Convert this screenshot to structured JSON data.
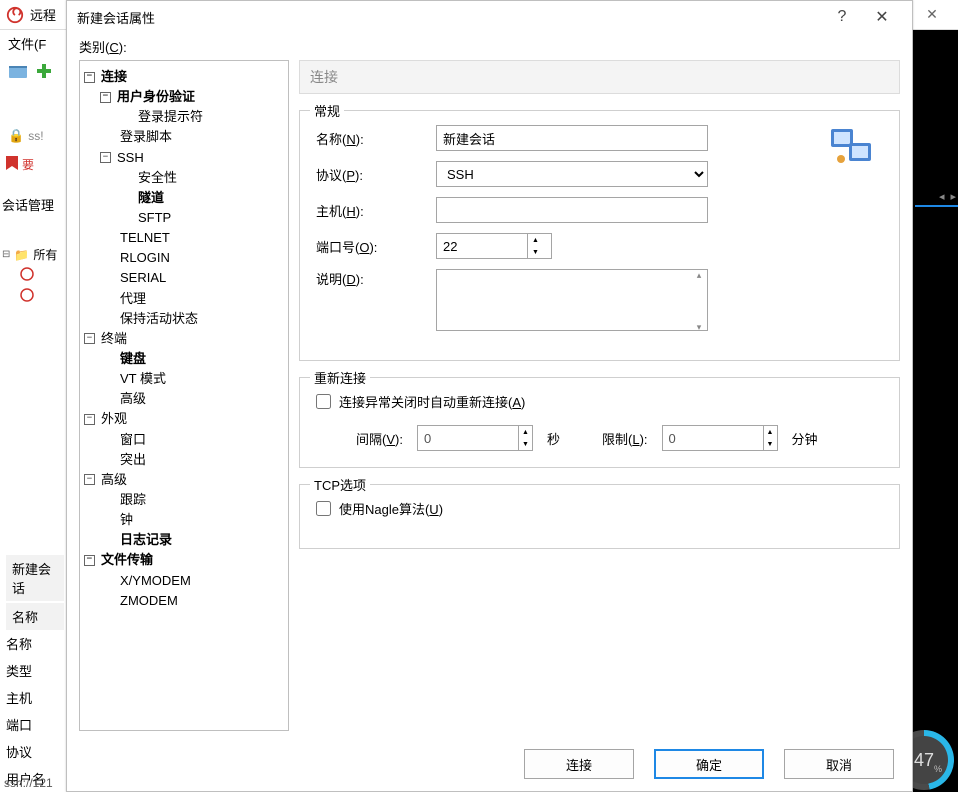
{
  "bg": {
    "title": "远程",
    "menu_file": "文件(F",
    "tab_closed": "ss!",
    "tab_bookmarks": "要",
    "session_manager": "会话管理",
    "tree_all": "所有",
    "status": "ssh://121",
    "progress": "47",
    "details": {
      "header": "新建会话",
      "name_label": "名称",
      "name_value": "名称",
      "type_label": "类型",
      "host_label": "主机",
      "port_label": "端口",
      "protocol_label": "协议",
      "user_label": "用户名"
    }
  },
  "dialog": {
    "title": "新建会话属性",
    "category_label": "类别(C):",
    "content_header": "连接",
    "tree": {
      "connection": "连接",
      "auth": "用户身份验证",
      "login_prompt": "登录提示符",
      "login_script": "登录脚本",
      "ssh": "SSH",
      "security": "安全性",
      "tunnel": "隧道",
      "sftp": "SFTP",
      "telnet": "TELNET",
      "rlogin": "RLOGIN",
      "serial": "SERIAL",
      "proxy": "代理",
      "keepalive": "保持活动状态",
      "terminal": "终端",
      "keyboard": "键盘",
      "vtmode": "VT 模式",
      "advanced": "高级",
      "appearance": "外观",
      "window": "窗口",
      "highlight": "突出",
      "advanced2": "高级",
      "trace": "跟踪",
      "clock": "钟",
      "log": "日志记录",
      "filetransfer": "文件传输",
      "xymodem": "X/YMODEM",
      "zmodem": "ZMODEM"
    },
    "general": {
      "legend": "常规",
      "name_label": "名称(N):",
      "name_value": "新建会话",
      "protocol_label": "协议(P):",
      "protocol_value": "SSH",
      "host_label": "主机(H):",
      "host_value": "",
      "port_label": "端口号(O):",
      "port_value": "22",
      "desc_label": "说明(D):",
      "desc_value": ""
    },
    "reconnect": {
      "legend": "重新连接",
      "checkbox_label": "连接异常关闭时自动重新连接(A)",
      "interval_label": "间隔(V):",
      "interval_value": "0",
      "interval_unit": "秒",
      "limit_label": "限制(L):",
      "limit_value": "0",
      "limit_unit": "分钟"
    },
    "tcp": {
      "legend": "TCP选项",
      "nagle_label": "使用Nagle算法(U)"
    },
    "buttons": {
      "connect": "连接",
      "ok": "确定",
      "cancel": "取消"
    }
  }
}
